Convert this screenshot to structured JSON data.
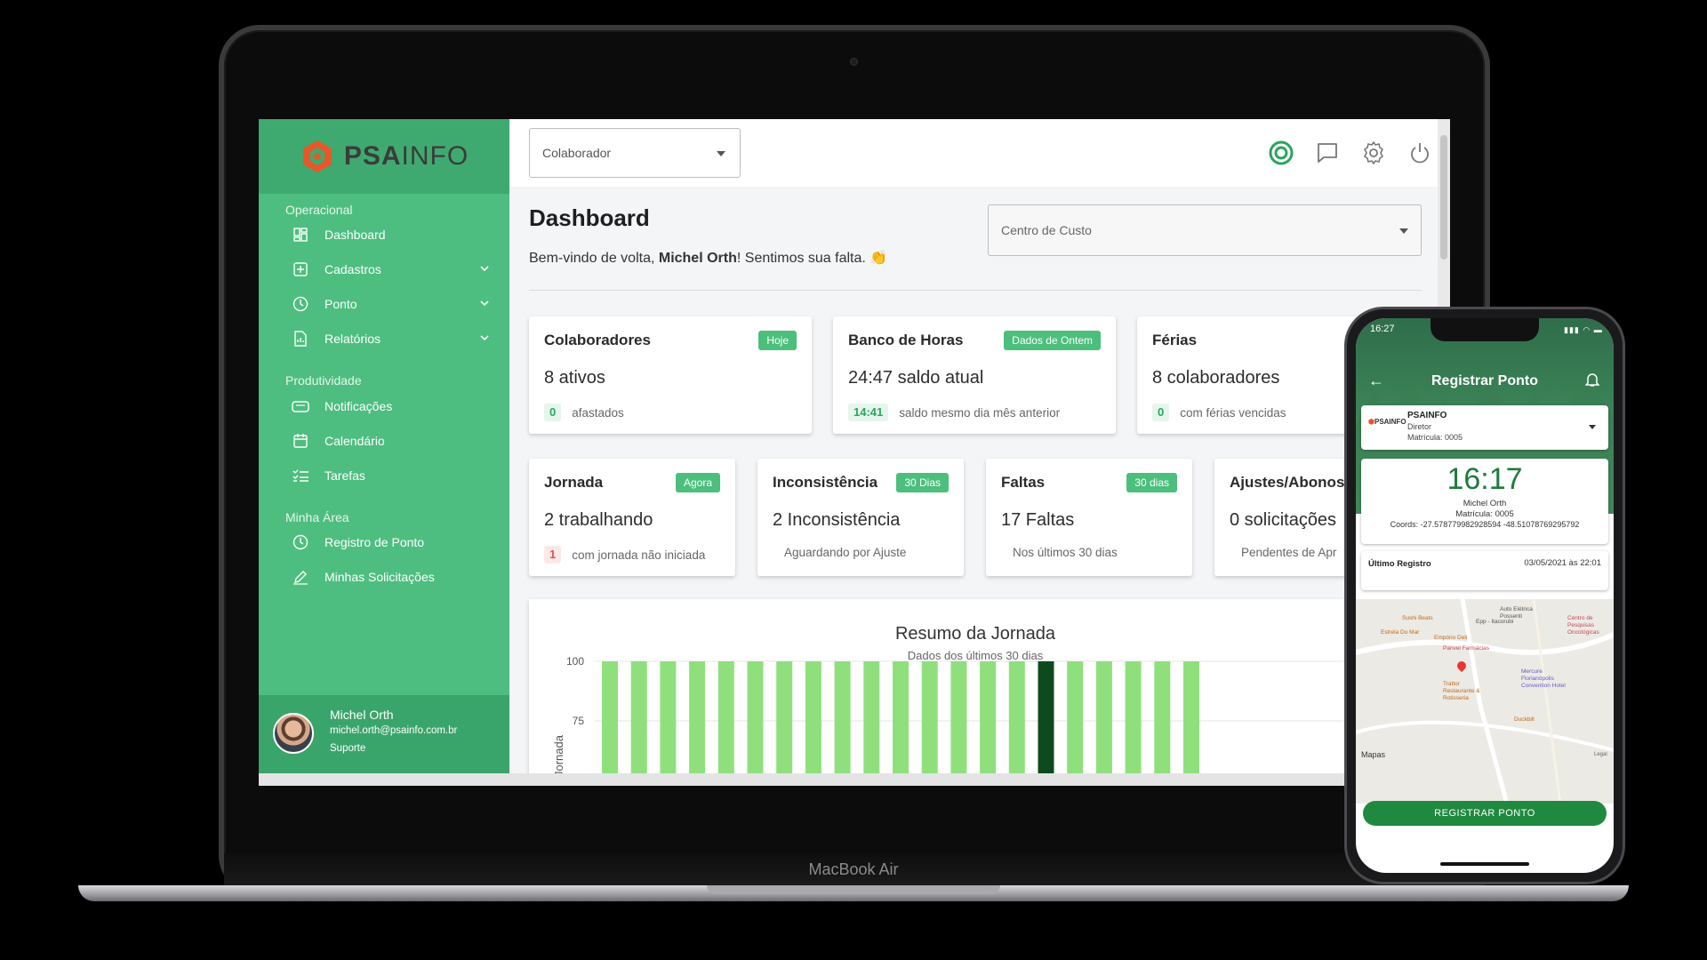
{
  "device": {
    "laptop_label": "MacBook Air"
  },
  "brand": {
    "name_bold": "PSA",
    "name_light": "INFO",
    "accent": "#4dbe7f",
    "logo_color": "#e8572a"
  },
  "sidebar": {
    "sections": [
      {
        "title": "Operacional",
        "items": [
          {
            "label": "Dashboard",
            "icon": "dashboard-icon",
            "expandable": false
          },
          {
            "label": "Cadastros",
            "icon": "plus-square-icon",
            "expandable": true
          },
          {
            "label": "Ponto",
            "icon": "clock-icon",
            "expandable": true
          },
          {
            "label": "Relatórios",
            "icon": "report-icon",
            "expandable": true
          }
        ]
      },
      {
        "title": "Produtividade",
        "items": [
          {
            "label": "Notificações",
            "icon": "message-icon",
            "expandable": false
          },
          {
            "label": "Calendário",
            "icon": "calendar-icon",
            "expandable": false
          },
          {
            "label": "Tarefas",
            "icon": "tasks-icon",
            "expandable": false
          }
        ]
      },
      {
        "title": "Minha Área",
        "items": [
          {
            "label": "Registro de Ponto",
            "icon": "clock-icon",
            "expandable": false
          },
          {
            "label": "Minhas Solicitações",
            "icon": "pencil-icon",
            "expandable": false
          }
        ]
      }
    ],
    "user": {
      "name": "Michel Orth",
      "email": "michel.orth@psainfo.com.br",
      "role": "Suporte"
    }
  },
  "topbar": {
    "colaborador_placeholder": "Colaborador",
    "icons": [
      "target-icon",
      "chat-icon",
      "settings-icon",
      "power-icon"
    ]
  },
  "main": {
    "title": "Dashboard",
    "welcome_prefix": "Bem-vindo de volta, ",
    "welcome_name": "Michel Orth",
    "welcome_suffix": "! Sentimos sua falta. 👏",
    "centro_custo_placeholder": "Centro de Custo"
  },
  "cards_row1": [
    {
      "title": "Colaboradores",
      "badge": "Hoje",
      "value": "8 ativos",
      "pill": "0",
      "pill_kind": "g",
      "sub": "afastados"
    },
    {
      "title": "Banco de Horas",
      "badge": "Dados de Ontem",
      "value": "24:47 saldo atual",
      "pill": "14:41",
      "pill_kind": "g",
      "sub": "saldo mesmo dia mês anterior"
    },
    {
      "title": "Férias",
      "badge": "",
      "value": "8 colaboradores",
      "pill": "0",
      "pill_kind": "g",
      "sub": "com férias vencidas"
    }
  ],
  "cards_row2": [
    {
      "title": "Jornada",
      "badge": "Agora",
      "value": "2 trabalhando",
      "pill": "1",
      "pill_kind": "r",
      "sub": "com jornada não iniciada"
    },
    {
      "title": "Inconsistência",
      "badge": "30 Dias",
      "value": "2 Inconsistência",
      "pill": "",
      "pill_kind": "",
      "sub": "Aguardando por Ajuste"
    },
    {
      "title": "Faltas",
      "badge": "30 dias",
      "value": "17 Faltas",
      "pill": "",
      "pill_kind": "",
      "sub": "Nos últimos 30 dias"
    },
    {
      "title": "Ajustes/Abonos",
      "badge": "",
      "value": "0 solicitações",
      "pill": "",
      "pill_kind": "",
      "sub": "Pendentes de Apr"
    }
  ],
  "chart_data": {
    "type": "bar",
    "title": "Resumo da Jornada",
    "subtitle": "Dados dos últimos 30 dias",
    "ylabel": "Jornada",
    "yticks": [
      100,
      75
    ],
    "ylim": [
      0,
      100
    ],
    "values": [
      100,
      100,
      100,
      100,
      100,
      100,
      100,
      100,
      100,
      100,
      100,
      100,
      100,
      100,
      100,
      100,
      100,
      100,
      100,
      100,
      100
    ],
    "colors": [
      "#8fe07d",
      "#8fe07d",
      "#8fe07d",
      "#8fe07d",
      "#8fe07d",
      "#8fe07d",
      "#8fe07d",
      "#8fe07d",
      "#8fe07d",
      "#8fe07d",
      "#8fe07d",
      "#8fe07d",
      "#8fe07d",
      "#8fe07d",
      "#8fe07d",
      "#0f4a1f",
      "#8fe07d",
      "#8fe07d",
      "#8fe07d",
      "#8fe07d",
      "#8fe07d"
    ]
  },
  "phone": {
    "time": "16:27",
    "status_icons": "▮▮▮ ◠ ▬",
    "title": "Registrar Ponto",
    "company": {
      "name": "PSAINFO",
      "role": "Diretor",
      "matricula": "Matrícula: 0005",
      "logo_text": "PSAINFO"
    },
    "clock": {
      "time": "16:17",
      "name": "Michel Orth",
      "matricula": "Matrícula: 0005",
      "coords": "Coords: -27.578779982928594 -48.51078769295792"
    },
    "last": {
      "label": "Último Registro",
      "value": "03/05/2021 às 22:01"
    },
    "map": {
      "places": [
        "Auto Elétrica Possenti",
        "Centro de Pesquisas Oncológicas",
        "Sushi Beats",
        "Epp - Itacorubi",
        "Estrela Do Mar",
        "Empório Deli",
        "Panvel Farmácias",
        "Mercure Florianópolis Convention Hotel",
        "Trattor Restaurante & Rotisseria",
        "Duckbill"
      ],
      "attribution": "Mapas",
      "legal": "Legal"
    },
    "button": "REGISTRAR PONTO"
  }
}
